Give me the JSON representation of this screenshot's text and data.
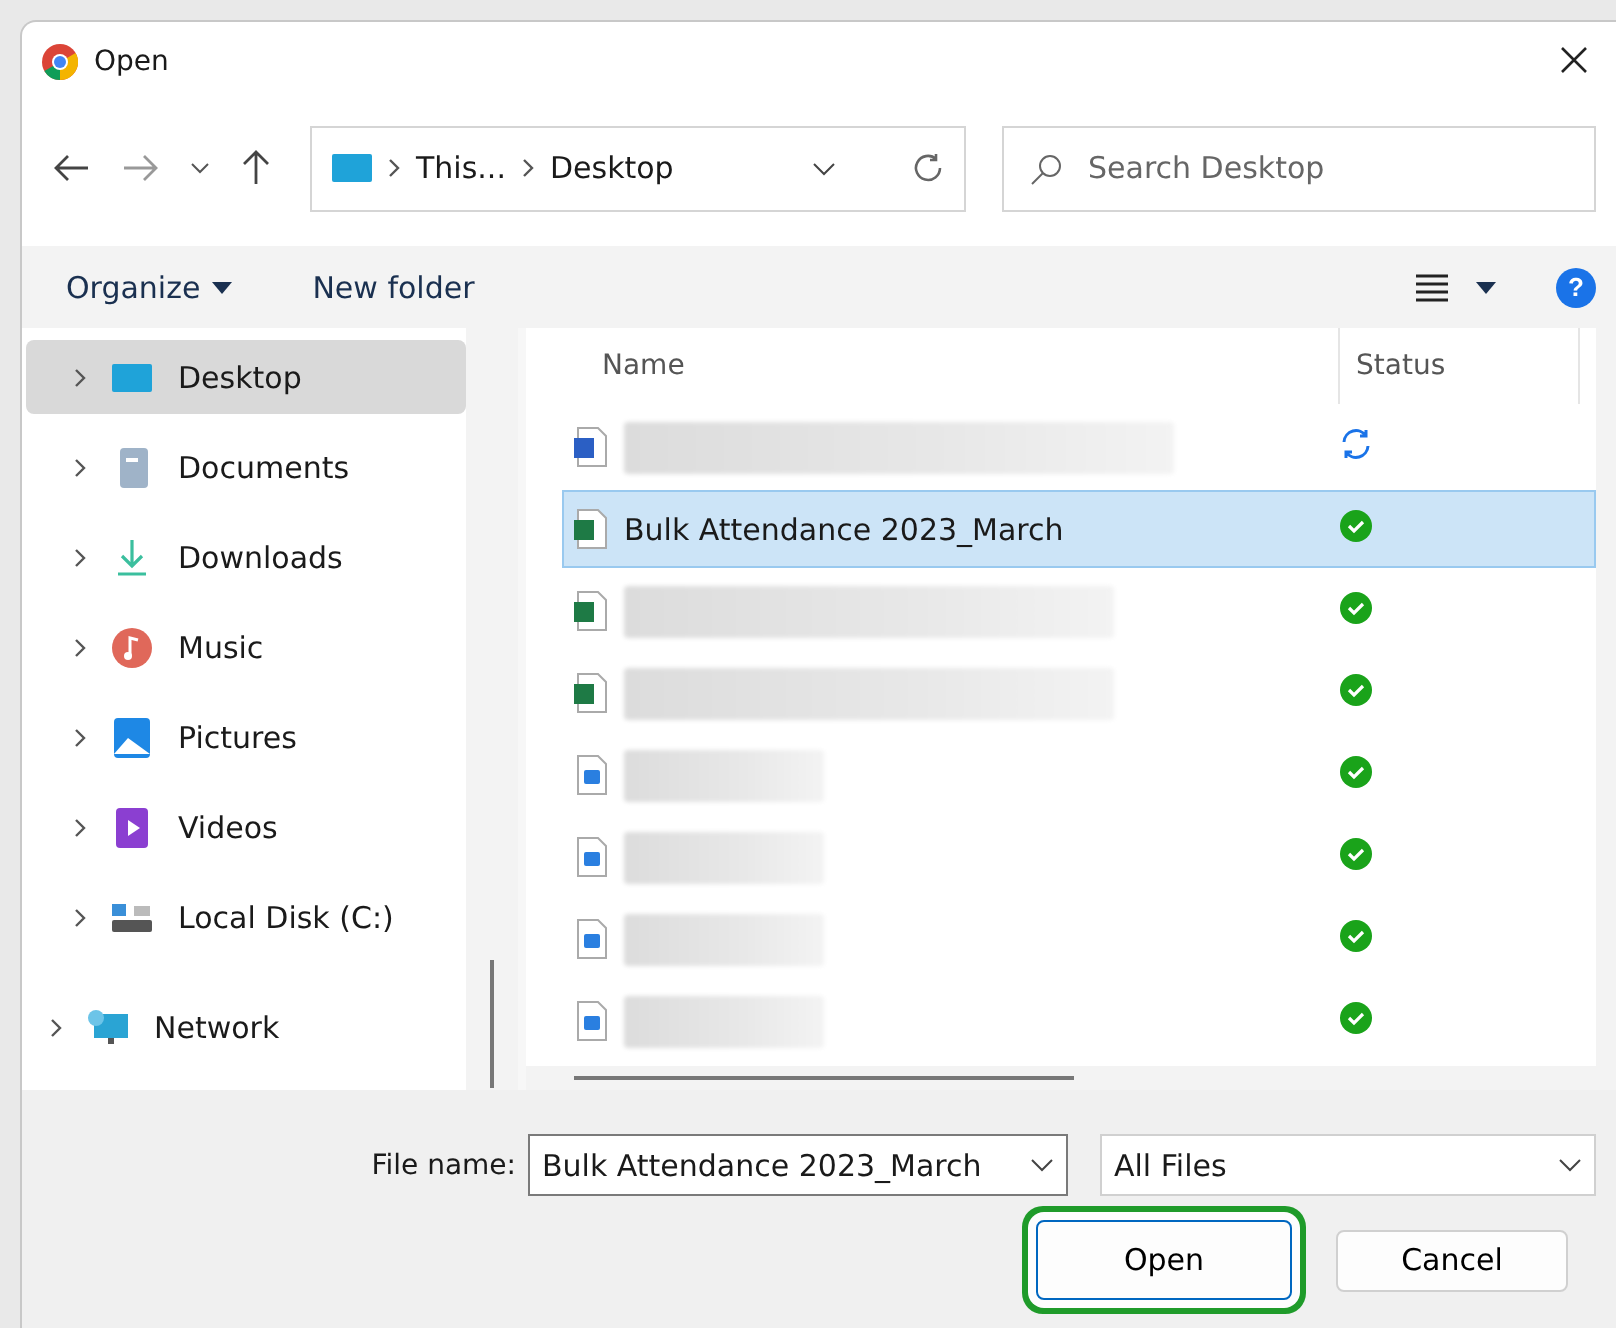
{
  "window": {
    "title": "Open"
  },
  "nav": {
    "breadcrumb": [
      "This...",
      "Desktop"
    ],
    "search_placeholder": "Search Desktop"
  },
  "commands": {
    "organize": "Organize",
    "new_folder": "New folder",
    "help": "?"
  },
  "sidebar": {
    "items": [
      {
        "label": "Desktop",
        "kind": "desktop",
        "selected": true
      },
      {
        "label": "Documents",
        "kind": "documents",
        "selected": false
      },
      {
        "label": "Downloads",
        "kind": "downloads",
        "selected": false
      },
      {
        "label": "Music",
        "kind": "music",
        "selected": false
      },
      {
        "label": "Pictures",
        "kind": "pictures",
        "selected": false
      },
      {
        "label": "Videos",
        "kind": "videos",
        "selected": false
      },
      {
        "label": "Local Disk (C:)",
        "kind": "disk",
        "selected": false
      },
      {
        "label": "Network",
        "kind": "network",
        "selected": false
      }
    ]
  },
  "table": {
    "columns": [
      "Name",
      "Status"
    ],
    "rows": [
      {
        "kind": "word",
        "synced": false,
        "selected": false
      },
      {
        "kind": "excel",
        "name": "Bulk Attendance 2023_March",
        "synced": true,
        "selected": true
      },
      {
        "kind": "excel",
        "synced": true,
        "selected": false
      },
      {
        "kind": "excel",
        "synced": true,
        "selected": false
      },
      {
        "kind": "image",
        "synced": true,
        "selected": false
      },
      {
        "kind": "image",
        "synced": true,
        "selected": false
      },
      {
        "kind": "image",
        "synced": true,
        "selected": false
      },
      {
        "kind": "image",
        "synced": true,
        "selected": false
      }
    ]
  },
  "footer": {
    "file_name_label": "File name:",
    "file_name": "Bulk Attendance 2023_March",
    "file_type": "All Files",
    "buttons": [
      {
        "label": "Open",
        "highlighted": true
      },
      {
        "label": "Cancel",
        "highlighted": false
      }
    ]
  }
}
